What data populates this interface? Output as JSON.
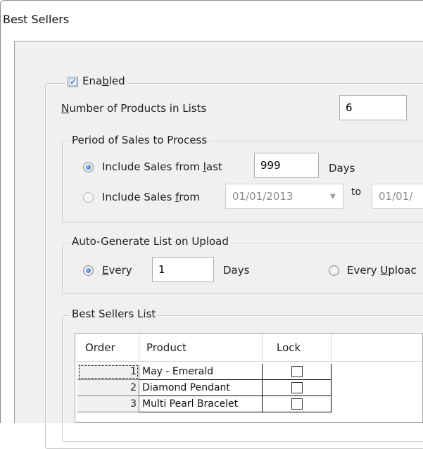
{
  "window": {
    "title": "Best Sellers"
  },
  "enabled": {
    "label_pre": "Ena",
    "label_accel": "b",
    "label_post": "led",
    "checked": true
  },
  "num_products": {
    "label_accel": "N",
    "label_rest": "umber of Products in Lists",
    "value": "6"
  },
  "period": {
    "title": "Period of Sales to Process",
    "option_last": {
      "label_pre": "Include Sales from ",
      "label_accel": "l",
      "label_post": "ast",
      "value": "999",
      "unit": "Days",
      "selected": true
    },
    "option_from": {
      "label_pre": "Include Sales ",
      "label_accel": "f",
      "label_post": "rom",
      "from_date": "01/01/2013",
      "to_label": "to",
      "to_date": "01/01/",
      "selected": false
    }
  },
  "autogen": {
    "title": "Auto-Generate List on Upload",
    "every": {
      "label_accel": "E",
      "label_post": "very",
      "value": "1",
      "unit": "Days",
      "selected": true
    },
    "every_upload": {
      "label_pre": "Every ",
      "label_accel": "U",
      "label_post": "ploac",
      "selected": false
    }
  },
  "best_sellers_list": {
    "title": "Best Sellers List",
    "columns": [
      "Order",
      "Product",
      "Lock"
    ],
    "rows": [
      {
        "order": "1",
        "product": "May - Emerald",
        "lock": false
      },
      {
        "order": "2",
        "product": "Diamond Pendant",
        "lock": false
      },
      {
        "order": "3",
        "product": "Multi Pearl Bracelet",
        "lock": false
      }
    ]
  }
}
